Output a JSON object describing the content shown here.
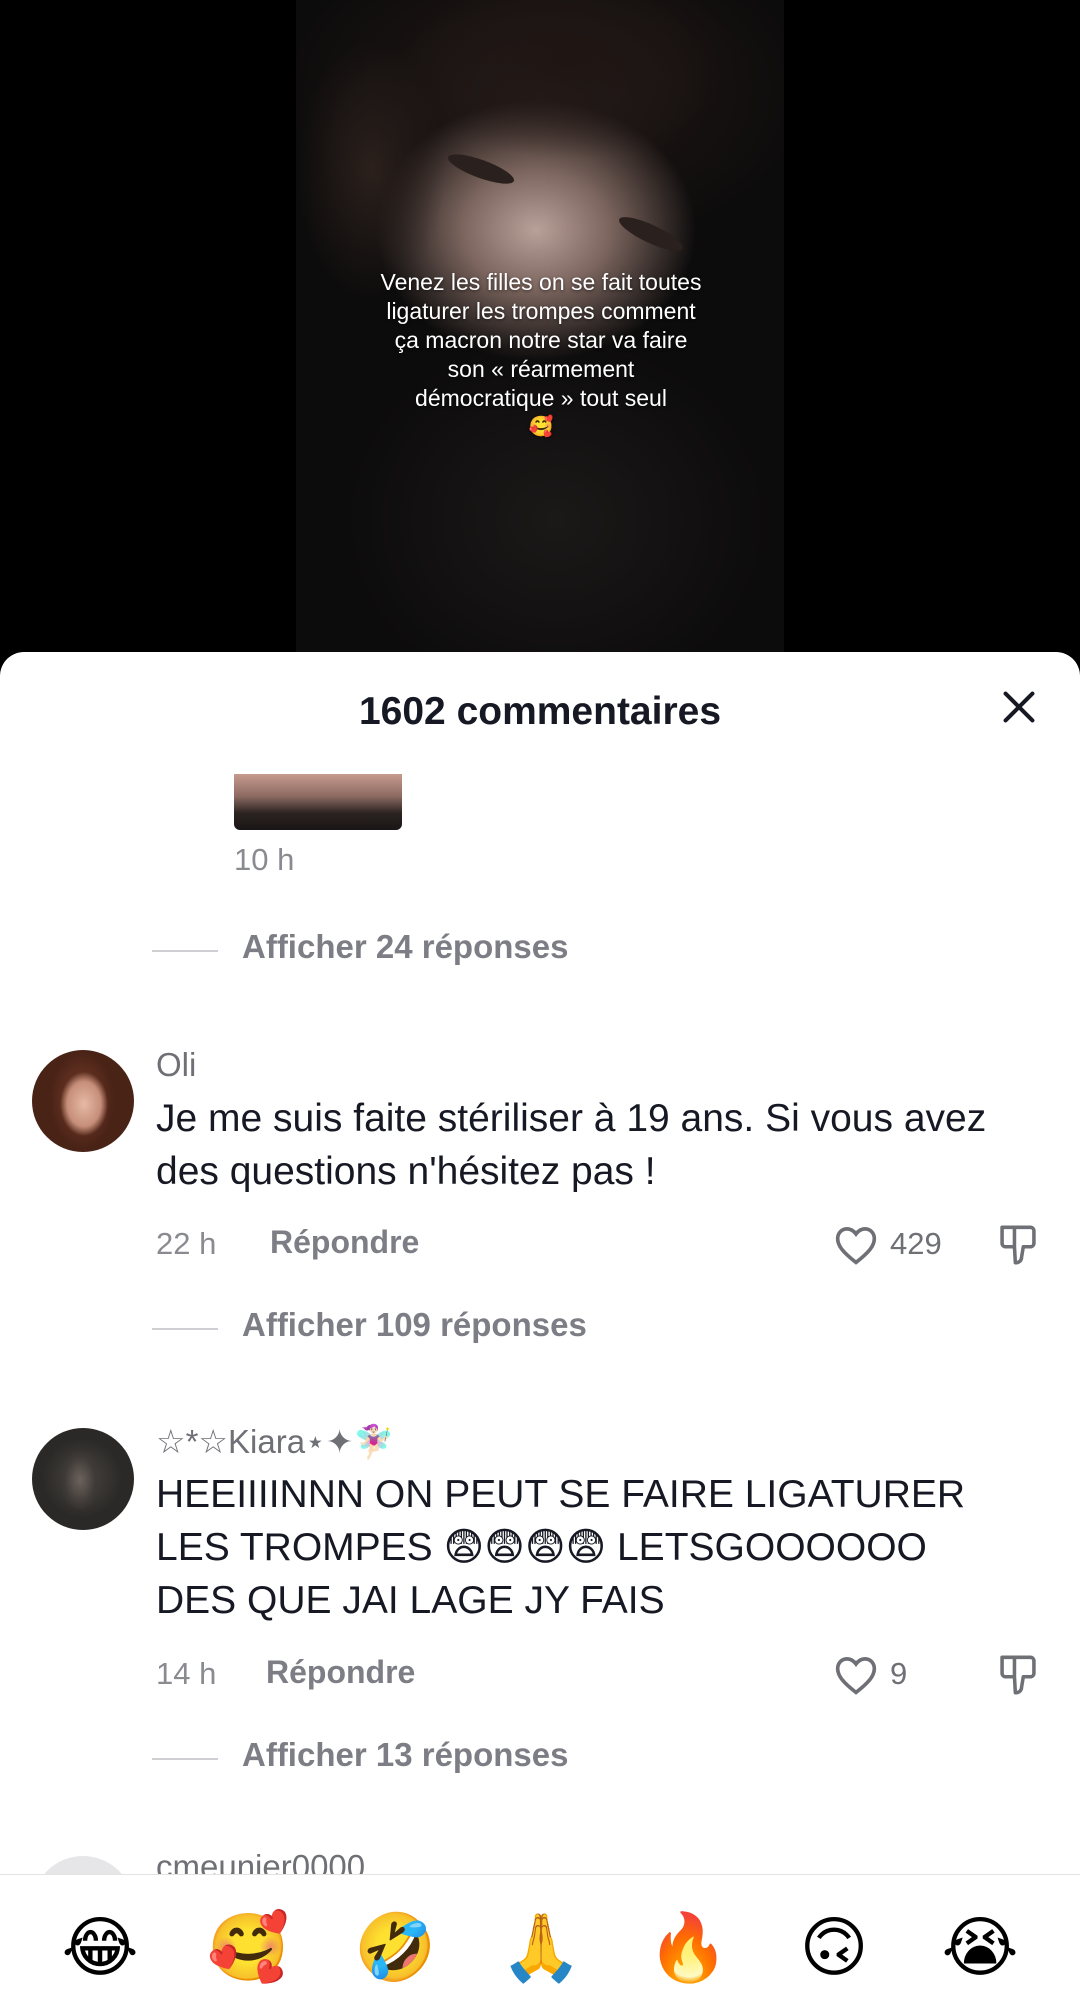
{
  "video": {
    "overlay_text": "Venez les filles on se fait toutes ligaturer les trompes comment ça macron notre star va faire son « réarmement démocratique » tout seul",
    "overlay_emoji": "🥰"
  },
  "sheet": {
    "title": "1602 commentaires",
    "close_icon": "close-icon"
  },
  "previous_comment": {
    "time": "10 h",
    "show_replies": "Afficher 24 réponses"
  },
  "comments": [
    {
      "username": "Oli",
      "text": "Je me suis faite stériliser à 19 ans. Si vous avez des questions n'hésitez pas !",
      "time": "22 h",
      "reply_label": "Répondre",
      "likes": "429",
      "show_replies": "Afficher 109 réponses"
    },
    {
      "username": "☆*☆Kiara⋆✦🧚🏻‍♀️",
      "text": "HEEIIIINNN ON PEUT SE FAIRE LIGATURER LES TROMPES 😨😨😨😨 LETSGOOOOOO DES QUE JAI LAGE JY FAIS",
      "time": "14 h",
      "reply_label": "Répondre",
      "likes": "9",
      "show_replies": "Afficher 13 réponses"
    }
  ],
  "partial_comment": {
    "username": "cmeunier0000"
  },
  "emoji_bar": [
    "😂",
    "🥰",
    "🤣",
    "🙏",
    "🔥",
    "🙃",
    "😭"
  ],
  "colors": {
    "text_primary": "#161823",
    "text_secondary": "#8a8b91"
  }
}
